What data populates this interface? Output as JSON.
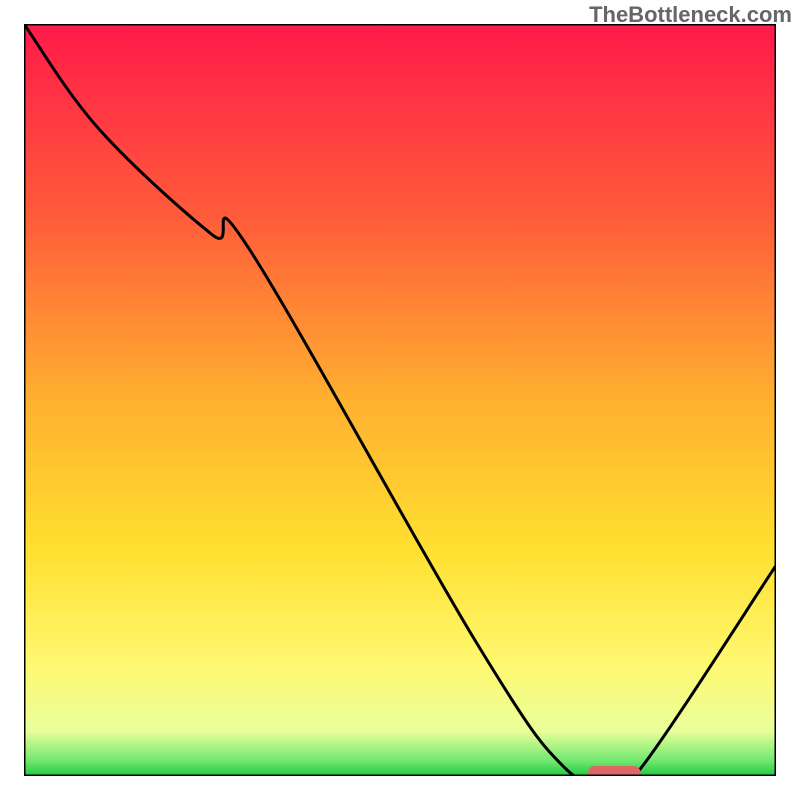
{
  "watermark": "TheBottleneck.com",
  "chart_data": {
    "type": "line",
    "title": "",
    "xlabel": "",
    "ylabel": "",
    "xlim": [
      0,
      100
    ],
    "ylim": [
      0,
      100
    ],
    "series": [
      {
        "name": "bottleneck-curve",
        "x": [
          0,
          10,
          25,
          30,
          60,
          72,
          78,
          82,
          100
        ],
        "y": [
          100,
          86,
          72,
          70,
          18,
          1,
          0,
          1,
          28
        ]
      }
    ],
    "marker": {
      "name": "optimal-range",
      "x_start": 75,
      "x_end": 82,
      "y": 0,
      "color": "#d66"
    },
    "gradient_stops": [
      {
        "offset": 0,
        "color": "#ff1a4a"
      },
      {
        "offset": 25,
        "color": "#ff5a3a"
      },
      {
        "offset": 50,
        "color": "#ffb030"
      },
      {
        "offset": 70,
        "color": "#ffe030"
      },
      {
        "offset": 85,
        "color": "#fff870"
      },
      {
        "offset": 94,
        "color": "#eaff9a"
      },
      {
        "offset": 98,
        "color": "#70e870"
      },
      {
        "offset": 100,
        "color": "#20c840"
      }
    ]
  }
}
